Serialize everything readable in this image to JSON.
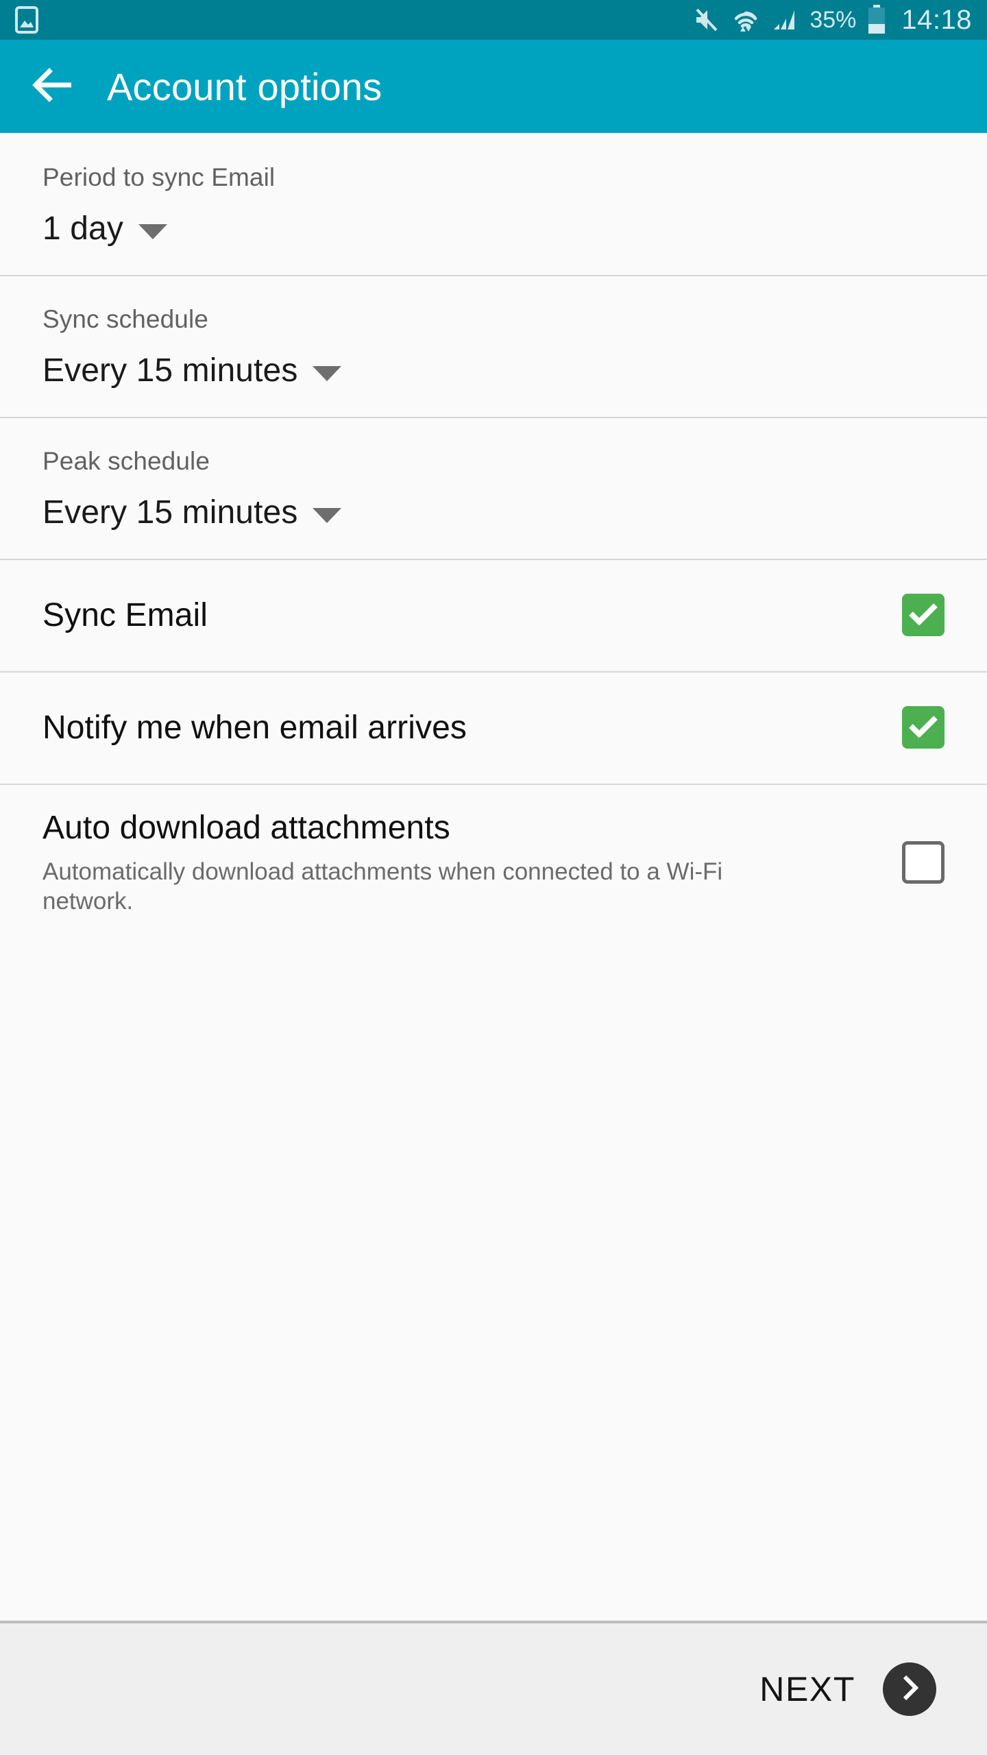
{
  "status_bar": {
    "notification_icon": "image-notification-icon",
    "icons": [
      "mute-icon",
      "wifi-icon",
      "signal-icon"
    ],
    "battery_percent": "35%",
    "battery_icon": "battery-icon",
    "time": "14:18",
    "background_color": "#007E92",
    "foreground_color": "#CFE9EE"
  },
  "app_bar": {
    "back_icon": "arrow-back-icon",
    "title": "Account options",
    "background_color": "#00A3BF",
    "title_color": "#FFFFFF"
  },
  "settings": {
    "spinners": [
      {
        "label": "Period to sync Email",
        "value": "1 day"
      },
      {
        "label": "Sync schedule",
        "value": "Every 15 minutes"
      },
      {
        "label": "Peak schedule",
        "value": "Every 15 minutes"
      }
    ],
    "checkboxes": [
      {
        "title": "Sync Email",
        "subtitle": "",
        "checked": true
      },
      {
        "title": "Notify me when email arrives",
        "subtitle": "",
        "checked": true
      },
      {
        "title": "Auto download attachments",
        "subtitle": "Automatically download attachments when connected to a Wi-Fi network.",
        "checked": false
      }
    ],
    "checked_color": "#4CAF50",
    "unchecked_border_color": "#6A6A6A"
  },
  "bottom_bar": {
    "next_label": "NEXT",
    "next_icon": "chevron-right-icon",
    "background_color": "#EFEFEF",
    "circle_color": "#333333"
  }
}
